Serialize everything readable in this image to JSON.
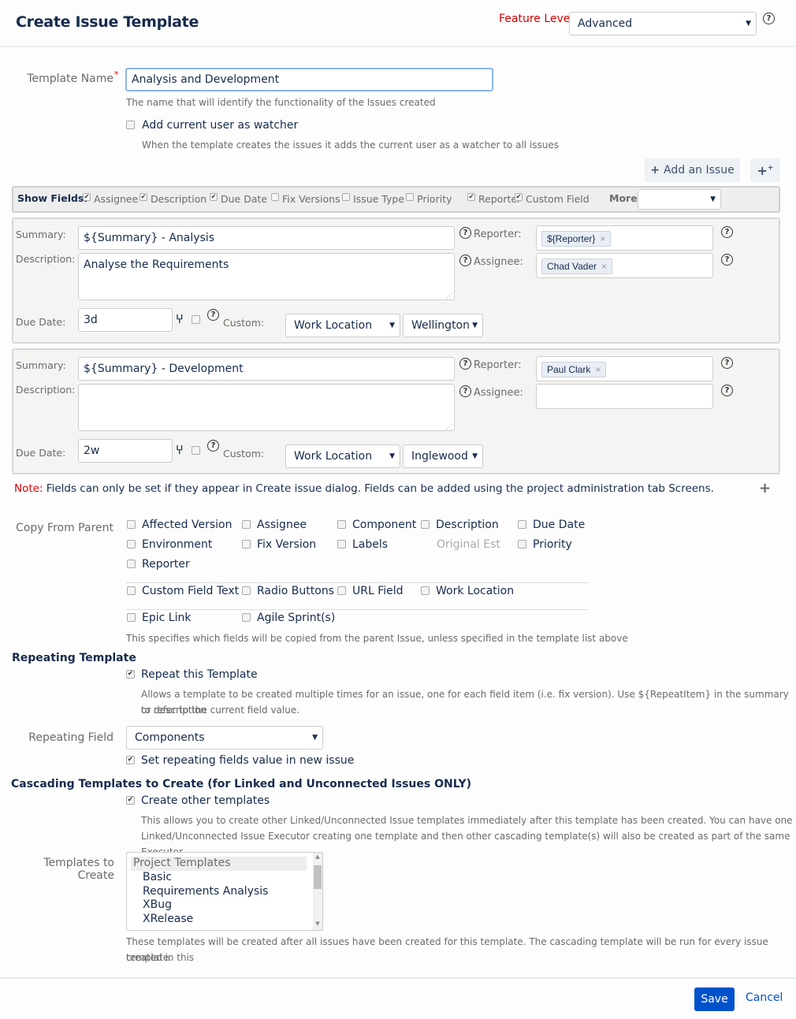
{
  "header": {
    "title": "Create Issue Template",
    "feature_level_label": "Feature Level",
    "feature_level_value": "Advanced"
  },
  "template_name": {
    "label": "Template Name",
    "required_mark": "*",
    "value": "Analysis and Development",
    "hint": "The name that will identify the functionality of the Issues created"
  },
  "watcher": {
    "label": "Add current user as watcher",
    "checked": false,
    "hint": "When the template creates the issues it adds the current user as a watcher to all issues"
  },
  "toolbar": {
    "add_issue_label": "Add an Issue"
  },
  "show_fields": {
    "label": "Show Fields:",
    "items": [
      {
        "label": "Assignee",
        "checked": true
      },
      {
        "label": "Description",
        "checked": true
      },
      {
        "label": "Due Date",
        "checked": true
      },
      {
        "label": "Fix Versions",
        "checked": false
      },
      {
        "label": "Issue Type",
        "checked": false
      },
      {
        "label": "Priority",
        "checked": false
      },
      {
        "label": "Reporter",
        "checked": true
      },
      {
        "label": "Custom Field",
        "checked": true
      }
    ],
    "more_label": "More",
    "more_value": ""
  },
  "issue_labels": {
    "summary": "Summary:",
    "description": "Description:",
    "due_date": "Due Date:",
    "custom": "Custom:",
    "reporter": "Reporter:",
    "assignee": "Assignee:"
  },
  "issues": [
    {
      "summary": "${Summary} - Analysis",
      "description": "Analyse the Requirements",
      "due_date": "3d",
      "custom_field": "Work Location",
      "custom_value": "Wellington",
      "reporter": "${Reporter}",
      "assignee": "Chad Vader"
    },
    {
      "summary": "${Summary} - Development",
      "description": "",
      "due_date": "2w",
      "custom_field": "Work Location",
      "custom_value": "Inglewood",
      "reporter": "Paul Clark",
      "assignee": ""
    }
  ],
  "note": {
    "prefix": "Note:",
    "text": " Fields can only be set if they appear in Create issue dialog. Fields can be added using the project administration tab Screens."
  },
  "copy_from_parent": {
    "label": "Copy From Parent",
    "items": [
      {
        "label": "Affected Version",
        "checked": false
      },
      {
        "label": "Assignee",
        "checked": false
      },
      {
        "label": "Component",
        "checked": false
      },
      {
        "label": "Description",
        "checked": false
      },
      {
        "label": "Due Date",
        "checked": false
      },
      {
        "label": "Environment",
        "checked": false
      },
      {
        "label": "Fix Version",
        "checked": false
      },
      {
        "label": "Labels",
        "checked": false
      },
      {
        "label": "Original Est",
        "disabled": true
      },
      {
        "label": "Priority",
        "checked": false
      },
      {
        "label": "Reporter",
        "checked": false
      },
      {
        "label": "Custom Field Text",
        "checked": false
      },
      {
        "label": "Radio Buttons",
        "checked": false
      },
      {
        "label": "URL Field",
        "checked": false
      },
      {
        "label": "Work Location",
        "checked": false
      },
      {
        "label": "Epic Link",
        "checked": false
      },
      {
        "label": "Agile Sprint(s)",
        "checked": false
      }
    ],
    "hint": "This specifies which fields will be copied from the parent Issue, unless specified in the template list above"
  },
  "repeating": {
    "heading": "Repeating Template",
    "repeat_label": "Repeat this Template",
    "repeat_checked": true,
    "repeat_hint_1": "Allows a template to be created multiple times for an issue, one for each field item (i.e. fix version). Use ${RepeatItem} in the summary or description",
    "repeat_hint_2": "to refer to the current field value.",
    "field_label": "Repeating Field",
    "field_value": "Components",
    "set_value_label": "Set repeating fields value in new issue",
    "set_value_checked": true
  },
  "cascading": {
    "heading": "Cascading Templates to Create (for Linked and Unconnected Issues ONLY)",
    "create_label": "Create other templates",
    "create_checked": true,
    "hint_1": "This allows you to create other Linked/Unconnected Issue templates immediately after this template has been created. You can have one",
    "hint_2": "Linked/Unconnected Issue Executor creating one template and then other cascading template(s) will also be created as part of the same Executor.",
    "templates_label": "Templates to Create",
    "group_label": "Project Templates",
    "options": [
      "Basic",
      "Requirements Analysis",
      "XBug",
      "XRelease"
    ],
    "templates_hint_1": "These templates will be created after all issues have been created for this template. The cascading template will be run for every issue created in this",
    "templates_hint_2": "template."
  },
  "footer": {
    "save_label": "Save",
    "cancel_label": "Cancel"
  },
  "colors": {
    "primary": "#0052cc",
    "note_red": "#d00000",
    "focus_border": "#4c9aff"
  }
}
